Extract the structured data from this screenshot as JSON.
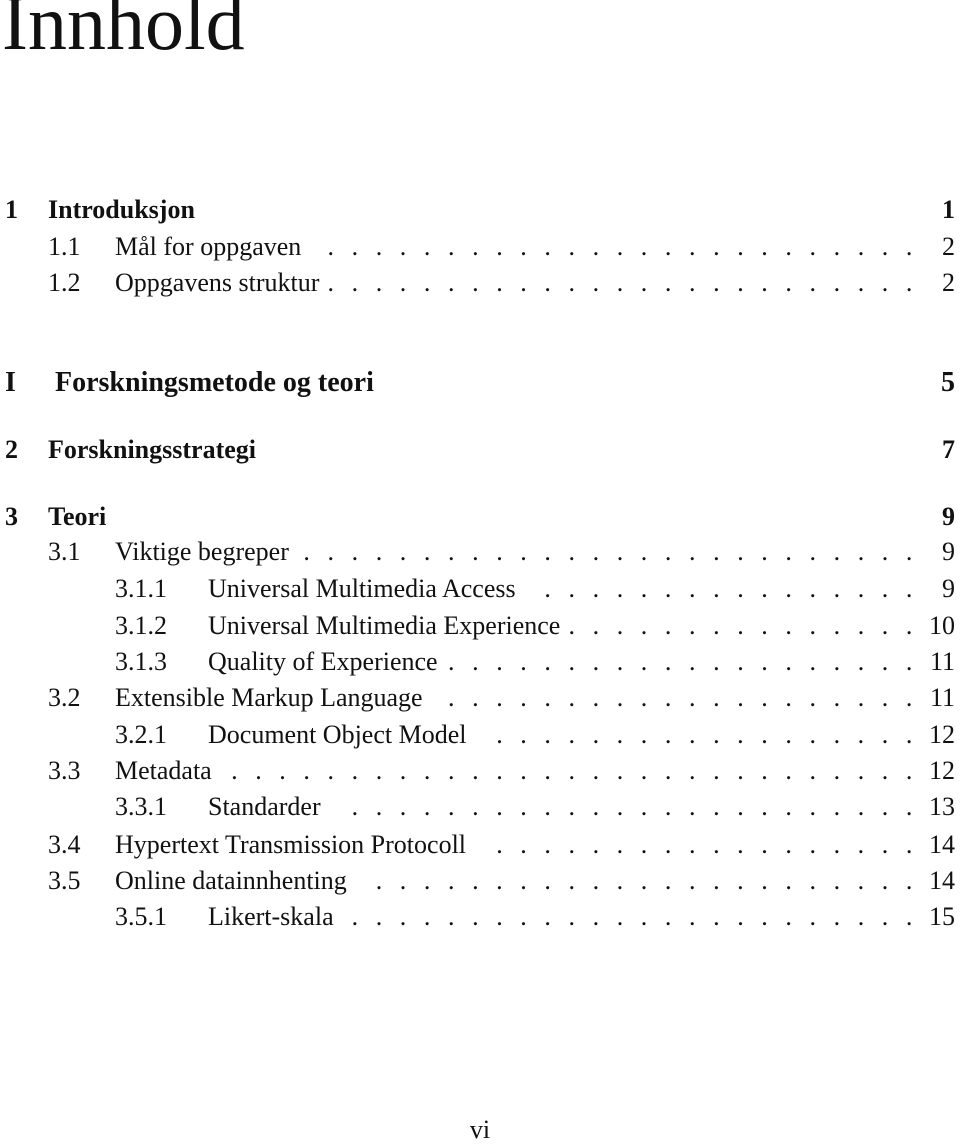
{
  "title": "Innhold",
  "entries": [
    {
      "level": "chapter",
      "number": "1",
      "title": "Introduksjon",
      "page": "1"
    },
    {
      "level": "section",
      "number": "1.1",
      "title": "Mål for oppgaven",
      "page": "2"
    },
    {
      "level": "section",
      "number": "1.2",
      "title": "Oppgavens struktur",
      "page": "2"
    },
    {
      "level": "part",
      "number": "I",
      "title": "Forskningsmetode og teori",
      "page": "5"
    },
    {
      "level": "chapter",
      "number": "2",
      "title": "Forskningsstrategi",
      "page": "7"
    },
    {
      "level": "chapter",
      "number": "3",
      "title": "Teori",
      "page": "9"
    },
    {
      "level": "section",
      "number": "3.1",
      "title": "Viktige begreper",
      "page": "9"
    },
    {
      "level": "subsection",
      "number": "3.1.1",
      "title": "Universal Multimedia Access",
      "page": "9"
    },
    {
      "level": "subsection",
      "number": "3.1.2",
      "title": "Universal Multimedia Experience",
      "page": "10"
    },
    {
      "level": "subsection",
      "number": "3.1.3",
      "title": "Quality of Experience",
      "page": "11"
    },
    {
      "level": "section",
      "number": "3.2",
      "title": "Extensible Markup Language",
      "page": "11"
    },
    {
      "level": "subsection",
      "number": "3.2.1",
      "title": "Document Object Model",
      "page": "12"
    },
    {
      "level": "section",
      "number": "3.3",
      "title": "Metadata",
      "page": "12"
    },
    {
      "level": "subsection",
      "number": "3.3.1",
      "title": "Standarder",
      "page": "13"
    },
    {
      "level": "section",
      "number": "3.4",
      "title": "Hypertext Transmission Protocoll",
      "page": "14"
    },
    {
      "level": "section",
      "number": "3.5",
      "title": "Online datainnhenting",
      "page": "14"
    },
    {
      "level": "subsection",
      "number": "3.5.1",
      "title": "Likert-skala",
      "page": "15"
    }
  ],
  "page_number": "vi"
}
